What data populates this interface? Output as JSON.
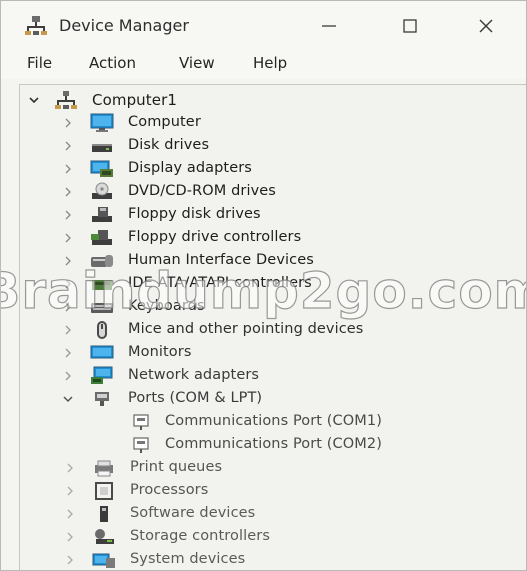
{
  "window": {
    "title": "Device Manager",
    "controls": {
      "minimize": "minimize-icon",
      "maximize": "maximize-icon",
      "close": "close-icon"
    }
  },
  "menu": [
    "File",
    "Action",
    "View",
    "Help"
  ],
  "tree": {
    "root": {
      "label": "Computer1",
      "expanded": true,
      "icon": "computer-network-icon"
    },
    "categories": [
      {
        "label": "Computer",
        "icon": "monitor-icon",
        "expanded": false
      },
      {
        "label": "Disk drives",
        "icon": "disk-drive-icon",
        "expanded": false
      },
      {
        "label": "Display adapters",
        "icon": "display-adapter-icon",
        "expanded": false
      },
      {
        "label": "DVD/CD-ROM drives",
        "icon": "dvd-drive-icon",
        "expanded": false
      },
      {
        "label": "Floppy disk drives",
        "icon": "floppy-drive-icon",
        "expanded": false
      },
      {
        "label": "Floppy drive controllers",
        "icon": "floppy-controller-icon",
        "expanded": false
      },
      {
        "label": "Human Interface Devices",
        "icon": "hid-icon",
        "expanded": false
      },
      {
        "label": "IDE ATA/ATAPI controllers",
        "icon": "ide-controller-icon",
        "expanded": false
      },
      {
        "label": "Keyboards",
        "icon": "keyboard-icon",
        "expanded": false
      },
      {
        "label": "Mice and other pointing devices",
        "icon": "mouse-icon",
        "expanded": false
      },
      {
        "label": "Monitors",
        "icon": "monitor-icon",
        "expanded": false
      },
      {
        "label": "Network adapters",
        "icon": "network-adapter-icon",
        "expanded": false
      },
      {
        "label": "Ports (COM & LPT)",
        "icon": "port-icon",
        "expanded": true,
        "children": [
          {
            "label": "Communications Port (COM1)",
            "icon": "com-port-icon"
          },
          {
            "label": "Communications Port (COM2)",
            "icon": "com-port-icon"
          }
        ]
      },
      {
        "label": "Print queues",
        "icon": "printer-icon",
        "expanded": false
      },
      {
        "label": "Processors",
        "icon": "processor-icon",
        "expanded": false
      },
      {
        "label": "Software devices",
        "icon": "software-device-icon",
        "expanded": false
      },
      {
        "label": "Storage controllers",
        "icon": "storage-controller-icon",
        "expanded": false
      },
      {
        "label": "System devices",
        "icon": "system-devices-icon",
        "expanded": false
      }
    ]
  },
  "watermark": "Braindump2go.com",
  "colors": {
    "text": "#1f1f1f",
    "text_faded": "#5a5a5a",
    "monitor_blue": "#1c8fd6",
    "icon_dark": "#4a4a4a"
  }
}
